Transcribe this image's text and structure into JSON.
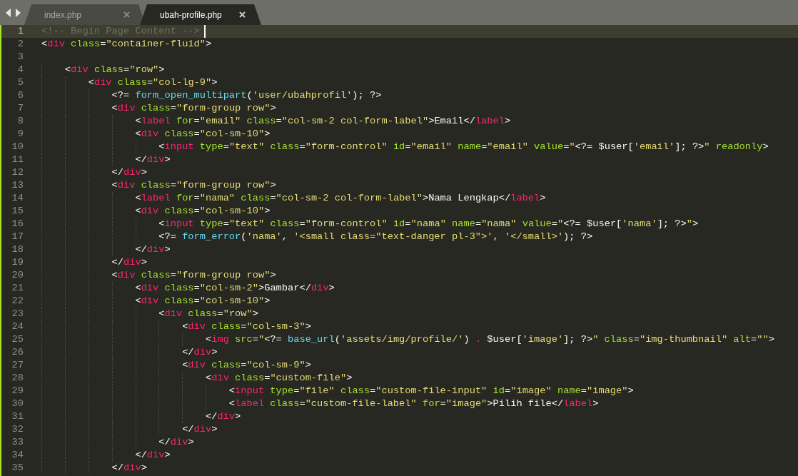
{
  "tabs": [
    {
      "label": "index.php",
      "selected": false
    },
    {
      "label": "ubah-profile.php",
      "selected": true
    }
  ],
  "lines": [
    {
      "number": "1",
      "current": true,
      "tokens": [
        {
          "kind": "comment",
          "text": "<!-- Begin Page Content -->"
        }
      ]
    },
    {
      "number": "2",
      "current": false,
      "tokens": [
        {
          "kind": "punct",
          "text": "<"
        },
        {
          "kind": "tag",
          "text": "div"
        },
        {
          "kind": "attr",
          "text": " class"
        },
        {
          "kind": "punct",
          "text": "="
        },
        {
          "kind": "string",
          "text": "\"container-fluid\""
        },
        {
          "kind": "punct",
          "text": ">"
        }
      ]
    },
    {
      "number": "3",
      "current": false
    },
    {
      "number": "4",
      "current": false,
      "tokens": [
        {
          "kind": "punct",
          "text": "    <"
        },
        {
          "kind": "tag",
          "text": "div"
        },
        {
          "kind": "attr",
          "text": " class"
        },
        {
          "kind": "punct",
          "text": "="
        },
        {
          "kind": "string",
          "text": "\"row\""
        },
        {
          "kind": "punct",
          "text": ">"
        }
      ]
    },
    {
      "number": "5",
      "current": false,
      "tokens": [
        {
          "kind": "punct",
          "text": "        <"
        },
        {
          "kind": "tag",
          "text": "div"
        },
        {
          "kind": "attr",
          "text": " class"
        },
        {
          "kind": "punct",
          "text": "="
        },
        {
          "kind": "string",
          "text": "\"col-lg-9\""
        },
        {
          "kind": "punct",
          "text": ">"
        }
      ]
    },
    {
      "number": "6",
      "current": false,
      "tokens": [
        {
          "kind": "punct",
          "text": "            <?= "
        },
        {
          "kind": "func",
          "text": "form_open_multipart"
        },
        {
          "kind": "punct",
          "text": "("
        },
        {
          "kind": "string",
          "text": "'user/ubahprofil'"
        },
        {
          "kind": "punct",
          "text": "); ?>"
        }
      ]
    },
    {
      "number": "7",
      "current": false,
      "tokens": [
        {
          "kind": "punct",
          "text": "            <"
        },
        {
          "kind": "tag",
          "text": "div"
        },
        {
          "kind": "attr",
          "text": " class"
        },
        {
          "kind": "punct",
          "text": "="
        },
        {
          "kind": "string",
          "text": "\"form-group row\""
        },
        {
          "kind": "punct",
          "text": ">"
        }
      ]
    },
    {
      "number": "8",
      "current": false,
      "tokens": [
        {
          "kind": "punct",
          "text": "                <"
        },
        {
          "kind": "tag",
          "text": "label"
        },
        {
          "kind": "attr",
          "text": " for"
        },
        {
          "kind": "punct",
          "text": "="
        },
        {
          "kind": "string",
          "text": "\"email\""
        },
        {
          "kind": "attr",
          "text": " class"
        },
        {
          "kind": "punct",
          "text": "="
        },
        {
          "kind": "string",
          "text": "\"col-sm-2 col-form-label\""
        },
        {
          "kind": "punct",
          "text": ">Email</"
        },
        {
          "kind": "tag",
          "text": "label"
        },
        {
          "kind": "punct",
          "text": ">"
        }
      ]
    },
    {
      "number": "9",
      "current": false,
      "tokens": [
        {
          "kind": "punct",
          "text": "                <"
        },
        {
          "kind": "tag",
          "text": "div"
        },
        {
          "kind": "attr",
          "text": " class"
        },
        {
          "kind": "punct",
          "text": "="
        },
        {
          "kind": "string",
          "text": "\"col-sm-10\""
        },
        {
          "kind": "punct",
          "text": ">"
        }
      ]
    },
    {
      "number": "10",
      "current": false,
      "tokens": [
        {
          "kind": "punct",
          "text": "                    <"
        },
        {
          "kind": "tag",
          "text": "input"
        },
        {
          "kind": "attr",
          "text": " type"
        },
        {
          "kind": "punct",
          "text": "="
        },
        {
          "kind": "string",
          "text": "\"text\""
        },
        {
          "kind": "attr",
          "text": " class"
        },
        {
          "kind": "punct",
          "text": "="
        },
        {
          "kind": "string",
          "text": "\"form-control\""
        },
        {
          "kind": "attr",
          "text": " id"
        },
        {
          "kind": "punct",
          "text": "="
        },
        {
          "kind": "string",
          "text": "\"email\""
        },
        {
          "kind": "attr",
          "text": " name"
        },
        {
          "kind": "punct",
          "text": "="
        },
        {
          "kind": "string",
          "text": "\"email\""
        },
        {
          "kind": "attr",
          "text": " value"
        },
        {
          "kind": "punct",
          "text": "="
        },
        {
          "kind": "string",
          "text": "\""
        },
        {
          "kind": "punct",
          "text": "<?= $user["
        },
        {
          "kind": "string",
          "text": "'email'"
        },
        {
          "kind": "punct",
          "text": "]; ?>"
        },
        {
          "kind": "string",
          "text": "\""
        },
        {
          "kind": "attr",
          "text": " readonly"
        },
        {
          "kind": "punct",
          "text": ">"
        }
      ]
    },
    {
      "number": "11",
      "current": false,
      "tokens": [
        {
          "kind": "punct",
          "text": "                </"
        },
        {
          "kind": "tag",
          "text": "div"
        },
        {
          "kind": "punct",
          "text": ">"
        }
      ]
    },
    {
      "number": "12",
      "current": false,
      "tokens": [
        {
          "kind": "punct",
          "text": "            </"
        },
        {
          "kind": "tag",
          "text": "div"
        },
        {
          "kind": "punct",
          "text": ">"
        }
      ]
    },
    {
      "number": "13",
      "current": false,
      "tokens": [
        {
          "kind": "punct",
          "text": "            <"
        },
        {
          "kind": "tag",
          "text": "div"
        },
        {
          "kind": "attr",
          "text": " class"
        },
        {
          "kind": "punct",
          "text": "="
        },
        {
          "kind": "string",
          "text": "\"form-group row\""
        },
        {
          "kind": "punct",
          "text": ">"
        }
      ]
    },
    {
      "number": "14",
      "current": false,
      "tokens": [
        {
          "kind": "punct",
          "text": "                <"
        },
        {
          "kind": "tag",
          "text": "label"
        },
        {
          "kind": "attr",
          "text": " for"
        },
        {
          "kind": "punct",
          "text": "="
        },
        {
          "kind": "string",
          "text": "\"nama\""
        },
        {
          "kind": "attr",
          "text": " class"
        },
        {
          "kind": "punct",
          "text": "="
        },
        {
          "kind": "string",
          "text": "\"col-sm-2 col-form-label\""
        },
        {
          "kind": "punct",
          "text": ">Nama Lengkap</"
        },
        {
          "kind": "tag",
          "text": "label"
        },
        {
          "kind": "punct",
          "text": ">"
        }
      ]
    },
    {
      "number": "15",
      "current": false,
      "tokens": [
        {
          "kind": "punct",
          "text": "                <"
        },
        {
          "kind": "tag",
          "text": "div"
        },
        {
          "kind": "attr",
          "text": " class"
        },
        {
          "kind": "punct",
          "text": "="
        },
        {
          "kind": "string",
          "text": "\"col-sm-10\""
        },
        {
          "kind": "punct",
          "text": ">"
        }
      ]
    },
    {
      "number": "16",
      "current": false,
      "tokens": [
        {
          "kind": "punct",
          "text": "                    <"
        },
        {
          "kind": "tag",
          "text": "input"
        },
        {
          "kind": "attr",
          "text": " type"
        },
        {
          "kind": "punct",
          "text": "="
        },
        {
          "kind": "string",
          "text": "\"text\""
        },
        {
          "kind": "attr",
          "text": " class"
        },
        {
          "kind": "punct",
          "text": "="
        },
        {
          "kind": "string",
          "text": "\"form-control\""
        },
        {
          "kind": "attr",
          "text": " id"
        },
        {
          "kind": "punct",
          "text": "="
        },
        {
          "kind": "string",
          "text": "\"nama\""
        },
        {
          "kind": "attr",
          "text": " name"
        },
        {
          "kind": "punct",
          "text": "="
        },
        {
          "kind": "string",
          "text": "\"nama\""
        },
        {
          "kind": "attr",
          "text": " value"
        },
        {
          "kind": "punct",
          "text": "="
        },
        {
          "kind": "string",
          "text": "\""
        },
        {
          "kind": "punct",
          "text": "<?= $user["
        },
        {
          "kind": "string",
          "text": "'nama'"
        },
        {
          "kind": "punct",
          "text": "]; ?>"
        },
        {
          "kind": "string",
          "text": "\""
        },
        {
          "kind": "punct",
          "text": ">"
        }
      ]
    },
    {
      "number": "17",
      "current": false,
      "tokens": [
        {
          "kind": "punct",
          "text": "                    <?= "
        },
        {
          "kind": "func",
          "text": "form_error"
        },
        {
          "kind": "punct",
          "text": "("
        },
        {
          "kind": "string",
          "text": "'nama'"
        },
        {
          "kind": "punct",
          "text": ", "
        },
        {
          "kind": "string",
          "text": "'<small class=\"text-danger pl-3\">'"
        },
        {
          "kind": "punct",
          "text": ", "
        },
        {
          "kind": "string",
          "text": "'</small>'"
        },
        {
          "kind": "punct",
          "text": "); ?>"
        }
      ]
    },
    {
      "number": "18",
      "current": false,
      "tokens": [
        {
          "kind": "punct",
          "text": "                </"
        },
        {
          "kind": "tag",
          "text": "div"
        },
        {
          "kind": "punct",
          "text": ">"
        }
      ]
    },
    {
      "number": "19",
      "current": false,
      "tokens": [
        {
          "kind": "punct",
          "text": "            </"
        },
        {
          "kind": "tag",
          "text": "div"
        },
        {
          "kind": "punct",
          "text": ">"
        }
      ]
    },
    {
      "number": "20",
      "current": false,
      "tokens": [
        {
          "kind": "punct",
          "text": "            <"
        },
        {
          "kind": "tag",
          "text": "div"
        },
        {
          "kind": "attr",
          "text": " class"
        },
        {
          "kind": "punct",
          "text": "="
        },
        {
          "kind": "string",
          "text": "\"form-group row\""
        },
        {
          "kind": "punct",
          "text": ">"
        }
      ]
    },
    {
      "number": "21",
      "current": false,
      "tokens": [
        {
          "kind": "punct",
          "text": "                <"
        },
        {
          "kind": "tag",
          "text": "div"
        },
        {
          "kind": "attr",
          "text": " class"
        },
        {
          "kind": "punct",
          "text": "="
        },
        {
          "kind": "string",
          "text": "\"col-sm-2\""
        },
        {
          "kind": "punct",
          "text": ">Gambar</"
        },
        {
          "kind": "tag",
          "text": "div"
        },
        {
          "kind": "punct",
          "text": ">"
        }
      ]
    },
    {
      "number": "22",
      "current": false,
      "tokens": [
        {
          "kind": "punct",
          "text": "                <"
        },
        {
          "kind": "tag",
          "text": "div"
        },
        {
          "kind": "attr",
          "text": " class"
        },
        {
          "kind": "punct",
          "text": "="
        },
        {
          "kind": "string",
          "text": "\"col-sm-10\""
        },
        {
          "kind": "punct",
          "text": ">"
        }
      ]
    },
    {
      "number": "23",
      "current": false,
      "tokens": [
        {
          "kind": "punct",
          "text": "                    <"
        },
        {
          "kind": "tag",
          "text": "div"
        },
        {
          "kind": "attr",
          "text": " class"
        },
        {
          "kind": "punct",
          "text": "="
        },
        {
          "kind": "string",
          "text": "\"row\""
        },
        {
          "kind": "punct",
          "text": ">"
        }
      ]
    },
    {
      "number": "24",
      "current": false,
      "tokens": [
        {
          "kind": "punct",
          "text": "                        <"
        },
        {
          "kind": "tag",
          "text": "div"
        },
        {
          "kind": "attr",
          "text": " class"
        },
        {
          "kind": "punct",
          "text": "="
        },
        {
          "kind": "string",
          "text": "\"col-sm-3\""
        },
        {
          "kind": "punct",
          "text": ">"
        }
      ]
    },
    {
      "number": "25",
      "current": false,
      "tokens": [
        {
          "kind": "punct",
          "text": "                            <"
        },
        {
          "kind": "tag",
          "text": "img"
        },
        {
          "kind": "attr",
          "text": " src"
        },
        {
          "kind": "punct",
          "text": "="
        },
        {
          "kind": "string",
          "text": "\""
        },
        {
          "kind": "punct",
          "text": "<?= "
        },
        {
          "kind": "func",
          "text": "base_url"
        },
        {
          "kind": "punct",
          "text": "("
        },
        {
          "kind": "string",
          "text": "'assets/img/profile/'"
        },
        {
          "kind": "punct",
          "text": ") "
        },
        {
          "kind": "tag",
          "text": "."
        },
        {
          "kind": "punct",
          "text": " $user["
        },
        {
          "kind": "string",
          "text": "'image'"
        },
        {
          "kind": "punct",
          "text": "]; ?>"
        },
        {
          "kind": "string",
          "text": "\""
        },
        {
          "kind": "attr",
          "text": " class"
        },
        {
          "kind": "punct",
          "text": "="
        },
        {
          "kind": "string",
          "text": "\"img-thumbnail\""
        },
        {
          "kind": "attr",
          "text": " alt"
        },
        {
          "kind": "punct",
          "text": "="
        },
        {
          "kind": "string",
          "text": "\"\""
        },
        {
          "kind": "punct",
          "text": ">"
        }
      ]
    },
    {
      "number": "26",
      "current": false,
      "tokens": [
        {
          "kind": "punct",
          "text": "                        </"
        },
        {
          "kind": "tag",
          "text": "div"
        },
        {
          "kind": "punct",
          "text": ">"
        }
      ]
    },
    {
      "number": "27",
      "current": false,
      "tokens": [
        {
          "kind": "punct",
          "text": "                        <"
        },
        {
          "kind": "tag",
          "text": "div"
        },
        {
          "kind": "attr",
          "text": " class"
        },
        {
          "kind": "punct",
          "text": "="
        },
        {
          "kind": "string",
          "text": "\"col-sm-9\""
        },
        {
          "kind": "punct",
          "text": ">"
        }
      ]
    },
    {
      "number": "28",
      "current": false,
      "tokens": [
        {
          "kind": "punct",
          "text": "                            <"
        },
        {
          "kind": "tag",
          "text": "div"
        },
        {
          "kind": "attr",
          "text": " class"
        },
        {
          "kind": "punct",
          "text": "="
        },
        {
          "kind": "string",
          "text": "\"custom-file\""
        },
        {
          "kind": "punct",
          "text": ">"
        }
      ]
    },
    {
      "number": "29",
      "current": false,
      "tokens": [
        {
          "kind": "punct",
          "text": "                                <"
        },
        {
          "kind": "tag",
          "text": "input"
        },
        {
          "kind": "attr",
          "text": " type"
        },
        {
          "kind": "punct",
          "text": "="
        },
        {
          "kind": "string",
          "text": "\"file\""
        },
        {
          "kind": "attr",
          "text": " class"
        },
        {
          "kind": "punct",
          "text": "="
        },
        {
          "kind": "string",
          "text": "\"custom-file-input\""
        },
        {
          "kind": "attr",
          "text": " id"
        },
        {
          "kind": "punct",
          "text": "="
        },
        {
          "kind": "string",
          "text": "\"image\""
        },
        {
          "kind": "attr",
          "text": " name"
        },
        {
          "kind": "punct",
          "text": "="
        },
        {
          "kind": "string",
          "text": "\"image\""
        },
        {
          "kind": "punct",
          "text": ">"
        }
      ]
    },
    {
      "number": "30",
      "current": false,
      "tokens": [
        {
          "kind": "punct",
          "text": "                                <"
        },
        {
          "kind": "tag",
          "text": "label"
        },
        {
          "kind": "attr",
          "text": " class"
        },
        {
          "kind": "punct",
          "text": "="
        },
        {
          "kind": "string",
          "text": "\"custom-file-label\""
        },
        {
          "kind": "attr",
          "text": " for"
        },
        {
          "kind": "punct",
          "text": "="
        },
        {
          "kind": "string",
          "text": "\"image\""
        },
        {
          "kind": "punct",
          "text": ">Pilih file</"
        },
        {
          "kind": "tag",
          "text": "label"
        },
        {
          "kind": "punct",
          "text": ">"
        }
      ]
    },
    {
      "number": "31",
      "current": false,
      "tokens": [
        {
          "kind": "punct",
          "text": "                            </"
        },
        {
          "kind": "tag",
          "text": "div"
        },
        {
          "kind": "punct",
          "text": ">"
        }
      ]
    },
    {
      "number": "32",
      "current": false,
      "tokens": [
        {
          "kind": "punct",
          "text": "                        </"
        },
        {
          "kind": "tag",
          "text": "div"
        },
        {
          "kind": "punct",
          "text": ">"
        }
      ]
    },
    {
      "number": "33",
      "current": false,
      "tokens": [
        {
          "kind": "punct",
          "text": "                    </"
        },
        {
          "kind": "tag",
          "text": "div"
        },
        {
          "kind": "punct",
          "text": ">"
        }
      ]
    },
    {
      "number": "34",
      "current": false,
      "tokens": [
        {
          "kind": "punct",
          "text": "                </"
        },
        {
          "kind": "tag",
          "text": "div"
        },
        {
          "kind": "punct",
          "text": ">"
        }
      ]
    },
    {
      "number": "35",
      "current": false,
      "tokens": [
        {
          "kind": "punct",
          "text": "            </"
        },
        {
          "kind": "tag",
          "text": "div"
        },
        {
          "kind": "punct",
          "text": ">"
        }
      ]
    }
  ]
}
